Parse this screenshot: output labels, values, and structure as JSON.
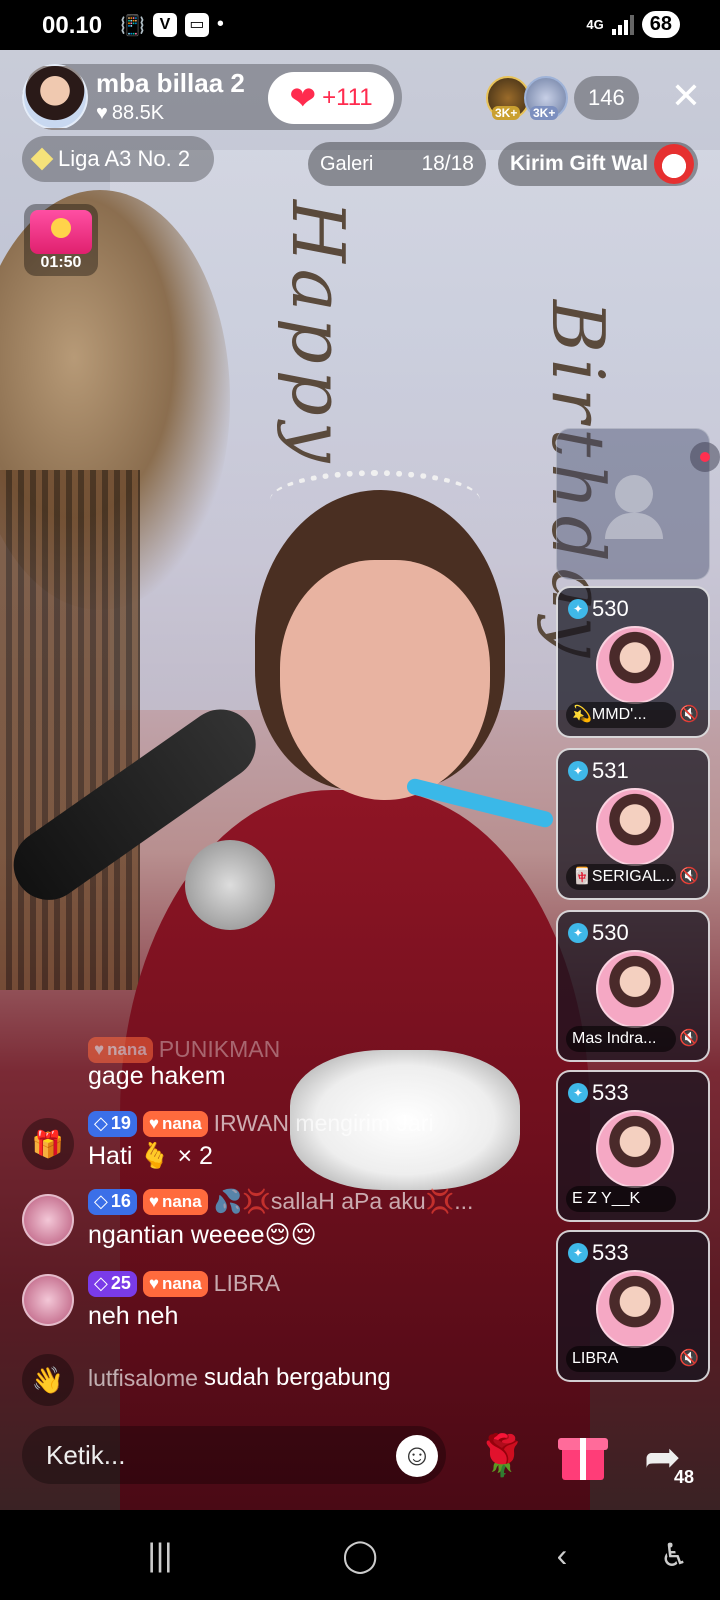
{
  "status_bar": {
    "time": "00.10",
    "network": "4G",
    "battery": "68"
  },
  "host": {
    "name": "mba billaa 2",
    "likes": "88.5K",
    "like_button": "+111"
  },
  "viewers": {
    "badge_1": "3K+",
    "badge_2": "3K+",
    "count": "146"
  },
  "liga": "Liga A3 No. 2",
  "galeri": {
    "label": "Galeri",
    "count": "18/18"
  },
  "kirim_gift": "Kirim Gift Wal",
  "timer": "01:50",
  "background": {
    "happy": "Happy",
    "birthday": "Birthday"
  },
  "guests": [
    {
      "score": "530",
      "label": "💫MMD'...",
      "muted": true
    },
    {
      "score": "531",
      "label": "🀄SERIGAL...",
      "muted": true
    },
    {
      "score": "530",
      "label": "Mas Indra...",
      "muted": true
    },
    {
      "score": "533",
      "label": "E Z Y__K",
      "muted": false
    },
    {
      "score": "533",
      "label": "LIBRA",
      "muted": true
    }
  ],
  "chat": [
    {
      "fan_badge": "nana",
      "username": "PUNIKMAN",
      "message": "gage hakem"
    },
    {
      "level": "19",
      "fan_badge": "nana",
      "username": "IRWAN mengirim Jari",
      "message": "Hati 🫰 × 2"
    },
    {
      "level": "16",
      "fan_badge": "nana",
      "username": "💦💢sallaH aPa aku💢...",
      "message": "ngantian weeee😌😌"
    },
    {
      "level": "25",
      "fan_badge": "nana",
      "username": "LIBRA",
      "message": "neh neh"
    },
    {
      "username": "lutfisalome",
      "message": "sudah bergabung"
    }
  ],
  "input": {
    "placeholder": "Ketik..."
  },
  "share_count": "48",
  "icons": {
    "close": "close-icon",
    "gift": "gift-icon",
    "rose": "rose-icon",
    "emoji": "emoji-icon",
    "share": "share-icon"
  }
}
